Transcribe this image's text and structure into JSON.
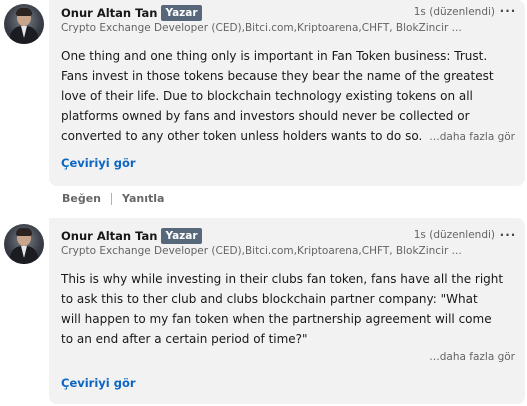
{
  "comments": [
    {
      "author": "Onur Altan Tan",
      "badge": "Yazar",
      "timestamp": "1s (düzenlendi)",
      "headline": "Crypto Exchange Developer (CED),Bitci.com,Kriptoarena,CHFT, BlokZincir ...",
      "lines": [
        "One thing and one thing only is important in Fan Token business: Trust.",
        "Fans invest in those tokens because they bear the name of the greatest",
        "love of their life. Due to blockchain technology existing tokens on all",
        "platforms owned by fans and investors should never be collected or",
        "converted to any other token unless holders wants to do so."
      ],
      "see_more": "…daha fazla gör",
      "translate": "Çeviriyi gör",
      "actions": {
        "like": "Beğen",
        "reply": "Yanıtla"
      }
    },
    {
      "author": "Onur Altan Tan",
      "badge": "Yazar",
      "timestamp": "1s (düzenlendi)",
      "headline": "Crypto Exchange Developer (CED),Bitci.com,Kriptoarena,CHFT, BlokZincir ...",
      "lines": [
        "This is why while investing in their clubs fan token, fans have all the right",
        "to ask this to ther club and clubs blockchain partner company: \"What",
        "will happen to my fan token when the partnership agreement will come",
        "to an end after a certain period of time?\""
      ],
      "see_more": "…daha fazla gör",
      "translate": "Çeviriyi gör"
    }
  ],
  "icons": {
    "more": "ellipsis-icon"
  }
}
